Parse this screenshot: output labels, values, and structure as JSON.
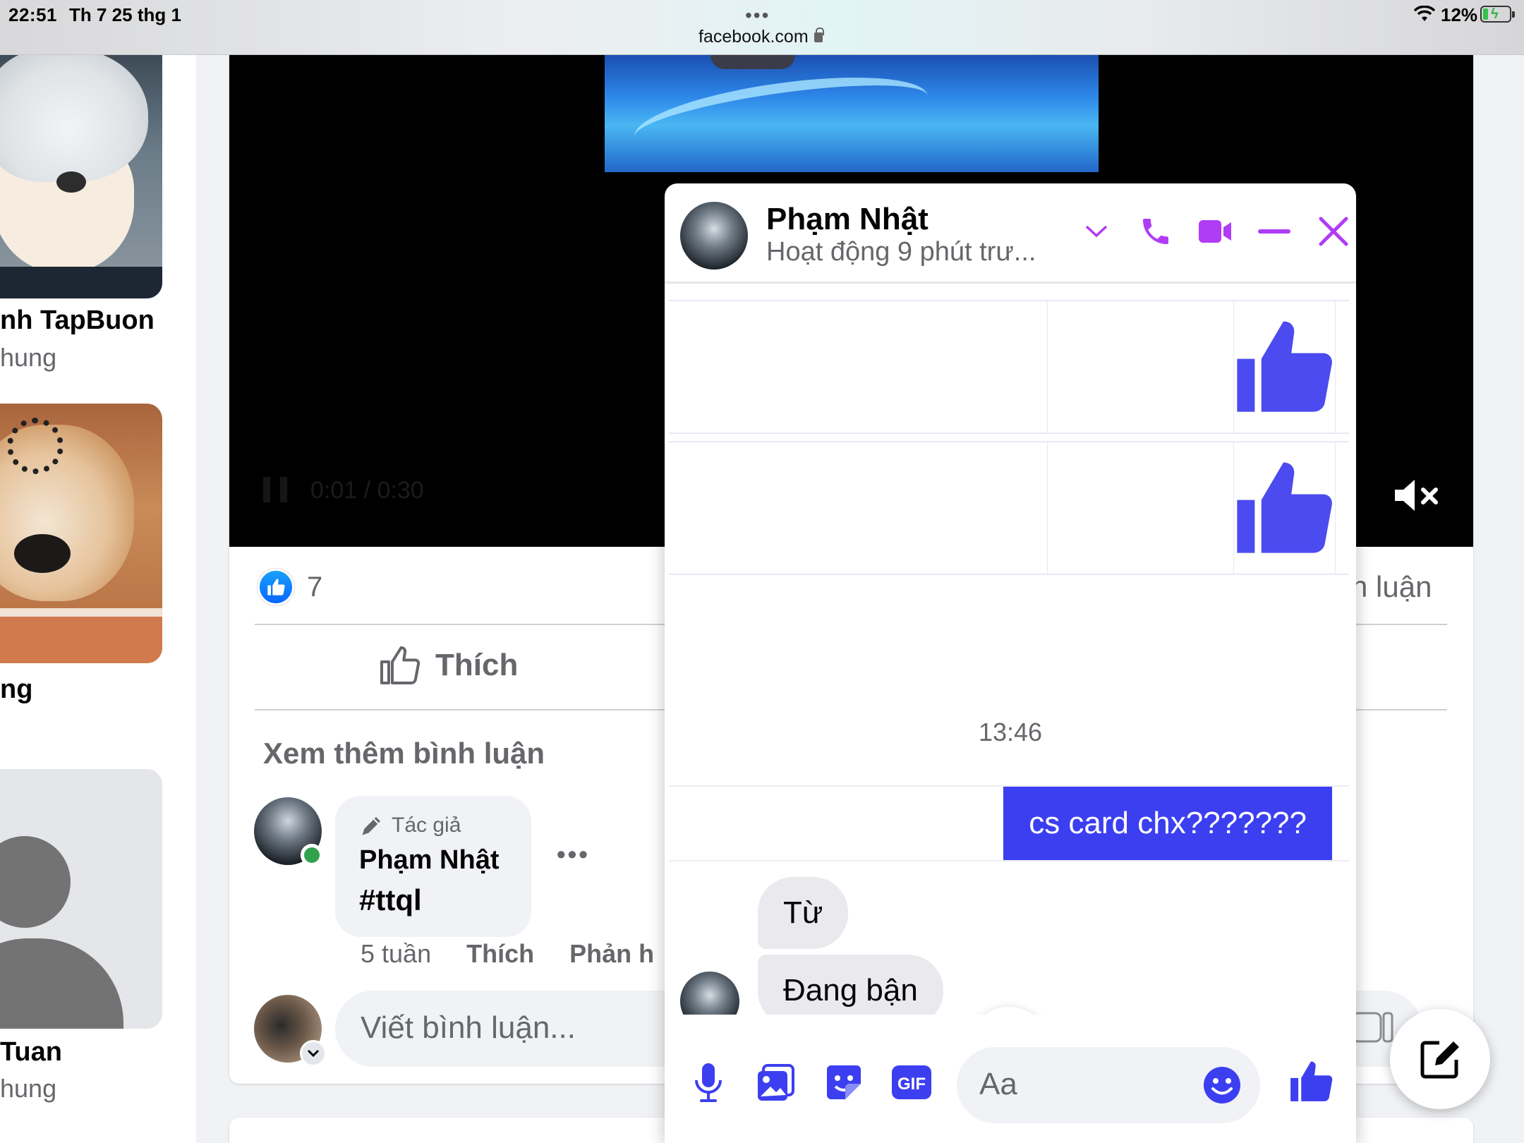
{
  "statusbar": {
    "time": "22:51",
    "date": "Th 7 25 thg 1",
    "url": "facebook.com",
    "battery": "12%"
  },
  "stories": [
    {
      "name": "nh TapBuon",
      "sub": "hung"
    },
    {
      "name": "ng",
      "sub": ""
    },
    {
      "name": "Tuan",
      "sub": "hung"
    }
  ],
  "post": {
    "video_time": "0:01 / 0:30",
    "like_count": "7",
    "comments_label": "h luận",
    "like_action": "Thích",
    "more_comments": "Xem thêm bình luận",
    "comment": {
      "author_badge": "Tác giả",
      "name": "Phạm Nhật",
      "text": "#ttql",
      "age": "5 tuần",
      "like": "Thích",
      "reply": "Phản h"
    },
    "comment_placeholder": "Viết bình luận..."
  },
  "chat": {
    "name": "Phạm Nhật",
    "status": "Hoạt động 9 phút trư...",
    "timestamp": "13:46",
    "sent_message": "cs card chx???????",
    "received": [
      "Từ",
      "Đang bận"
    ],
    "input_placeholder": "Aa",
    "accent": "#3c3ff0",
    "header_icon_color": "#b03cf5"
  },
  "icons": {
    "header": [
      "chevron-down-icon",
      "phone-icon",
      "video-call-icon",
      "minimize-icon",
      "close-icon"
    ],
    "footer": [
      "microphone-icon",
      "photo-icon",
      "sticker-icon",
      "gif-icon",
      "emoji-icon",
      "thumbs-up-icon"
    ],
    "gif_label": "GIF"
  }
}
